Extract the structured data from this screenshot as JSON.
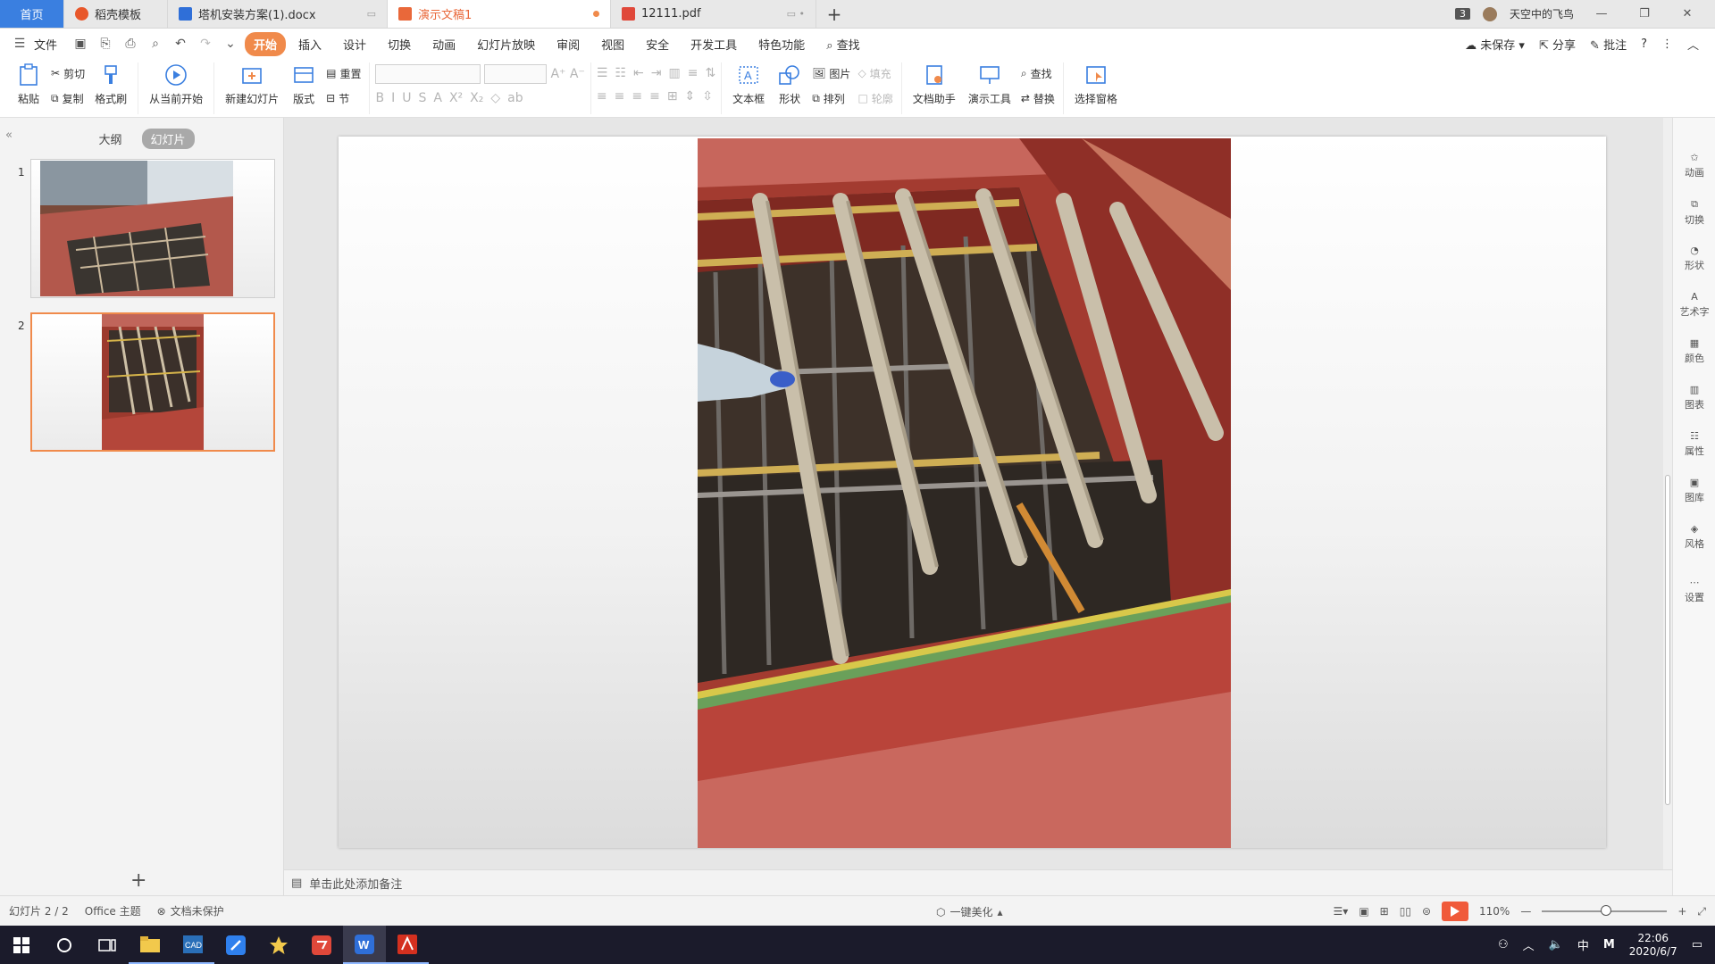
{
  "tabs": [
    {
      "label": "首页",
      "kind": "home"
    },
    {
      "label": "稻壳模板",
      "kind": "docer"
    },
    {
      "label": "塔机安装方案(1).docx",
      "kind": "word"
    },
    {
      "label": "演示文稿1",
      "kind": "ppt"
    },
    {
      "label": "12111.pdf",
      "kind": "pdf"
    }
  ],
  "title_right": {
    "window_count": "3",
    "user_name": "天空中的飞鸟"
  },
  "menu": {
    "file": "文件",
    "items": [
      "开始",
      "插入",
      "设计",
      "切换",
      "动画",
      "幻灯片放映",
      "审阅",
      "视图",
      "安全",
      "开发工具",
      "特色功能"
    ],
    "active": "开始",
    "search": "查找",
    "unsaved": "未保存",
    "share": "分享",
    "comment": "批注"
  },
  "ribbon": {
    "paste": "粘贴",
    "cut": "剪切",
    "copy": "复制",
    "format_painter": "格式刷",
    "from_current": "从当前开始",
    "new_slide": "新建幻灯片",
    "layout": "版式",
    "reset": "重置",
    "section": "节",
    "textbox": "文本框",
    "shape": "形状",
    "picture": "图片",
    "fill": "填充",
    "arrange": "排列",
    "outline": "轮廓",
    "doc_assistant": "文档助手",
    "presentation_tools": "演示工具",
    "find": "查找",
    "replace": "替换",
    "selection_pane": "选择窗格"
  },
  "left_panel": {
    "tab_outline": "大纲",
    "tab_slides": "幻灯片",
    "slides": [
      {
        "num": "1"
      },
      {
        "num": "2"
      }
    ],
    "selected": 2
  },
  "right_bar": [
    "动画",
    "切换",
    "形状",
    "艺术字",
    "颜色",
    "图表",
    "属性",
    "图库",
    "风格",
    "设置"
  ],
  "notes_placeholder": "单击此处添加备注",
  "status": {
    "slide_counter": "幻灯片 2 / 2",
    "theme": "Office 主题",
    "protection": "文档未保护",
    "beautify": "一键美化",
    "zoom": "110%"
  },
  "taskbar": {
    "time": "22:06",
    "date": "2020/6/7",
    "ime": "中",
    "ime2": "M"
  },
  "colors": {
    "accent": "#f08a4b",
    "home_tab": "#3a7fe0",
    "play": "#f05a3a"
  }
}
